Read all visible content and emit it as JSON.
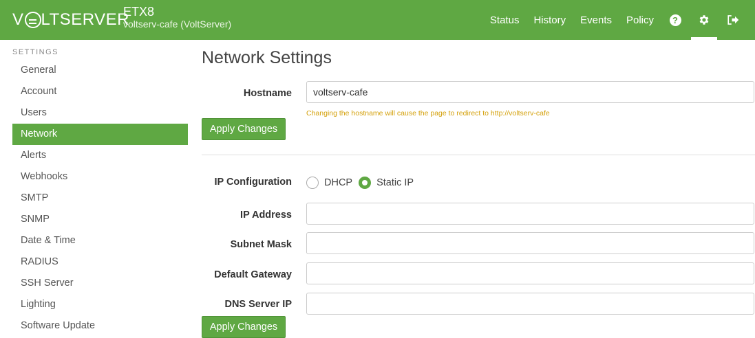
{
  "brand": {
    "logo_text_pre": "V",
    "logo_text_post": "LTSERVER"
  },
  "device": {
    "model": "ETX8",
    "name": "voltserv-cafe (VoltServer)"
  },
  "nav": {
    "links": [
      "Status",
      "History",
      "Events",
      "Policy"
    ],
    "icons": [
      "help-icon",
      "gear-icon",
      "logout-icon"
    ]
  },
  "sidebar": {
    "heading": "SETTINGS",
    "items": [
      "General",
      "Account",
      "Users",
      "Network",
      "Alerts",
      "Webhooks",
      "SMTP",
      "SNMP",
      "Date & Time",
      "RADIUS",
      "SSH Server",
      "Lighting",
      "Software Update"
    ],
    "active": "Network"
  },
  "main": {
    "title": "Network Settings",
    "hostname": {
      "label": "Hostname",
      "value": "voltserv-cafe",
      "hint": "Changing the hostname will cause the page to redirect to http://voltserv-cafe"
    },
    "apply_label": "Apply Changes",
    "ip_config": {
      "label": "IP Configuration",
      "options": [
        "DHCP",
        "Static IP"
      ],
      "selected": "Static IP"
    },
    "ip_address": {
      "label": "IP Address",
      "value": ""
    },
    "subnet_mask": {
      "label": "Subnet Mask",
      "value": ""
    },
    "default_gateway": {
      "label": "Default Gateway",
      "value": ""
    },
    "dns_server": {
      "label": "DNS Server IP",
      "value": ""
    }
  },
  "colors": {
    "accent": "#5fa843",
    "hint": "#d4a00a"
  }
}
